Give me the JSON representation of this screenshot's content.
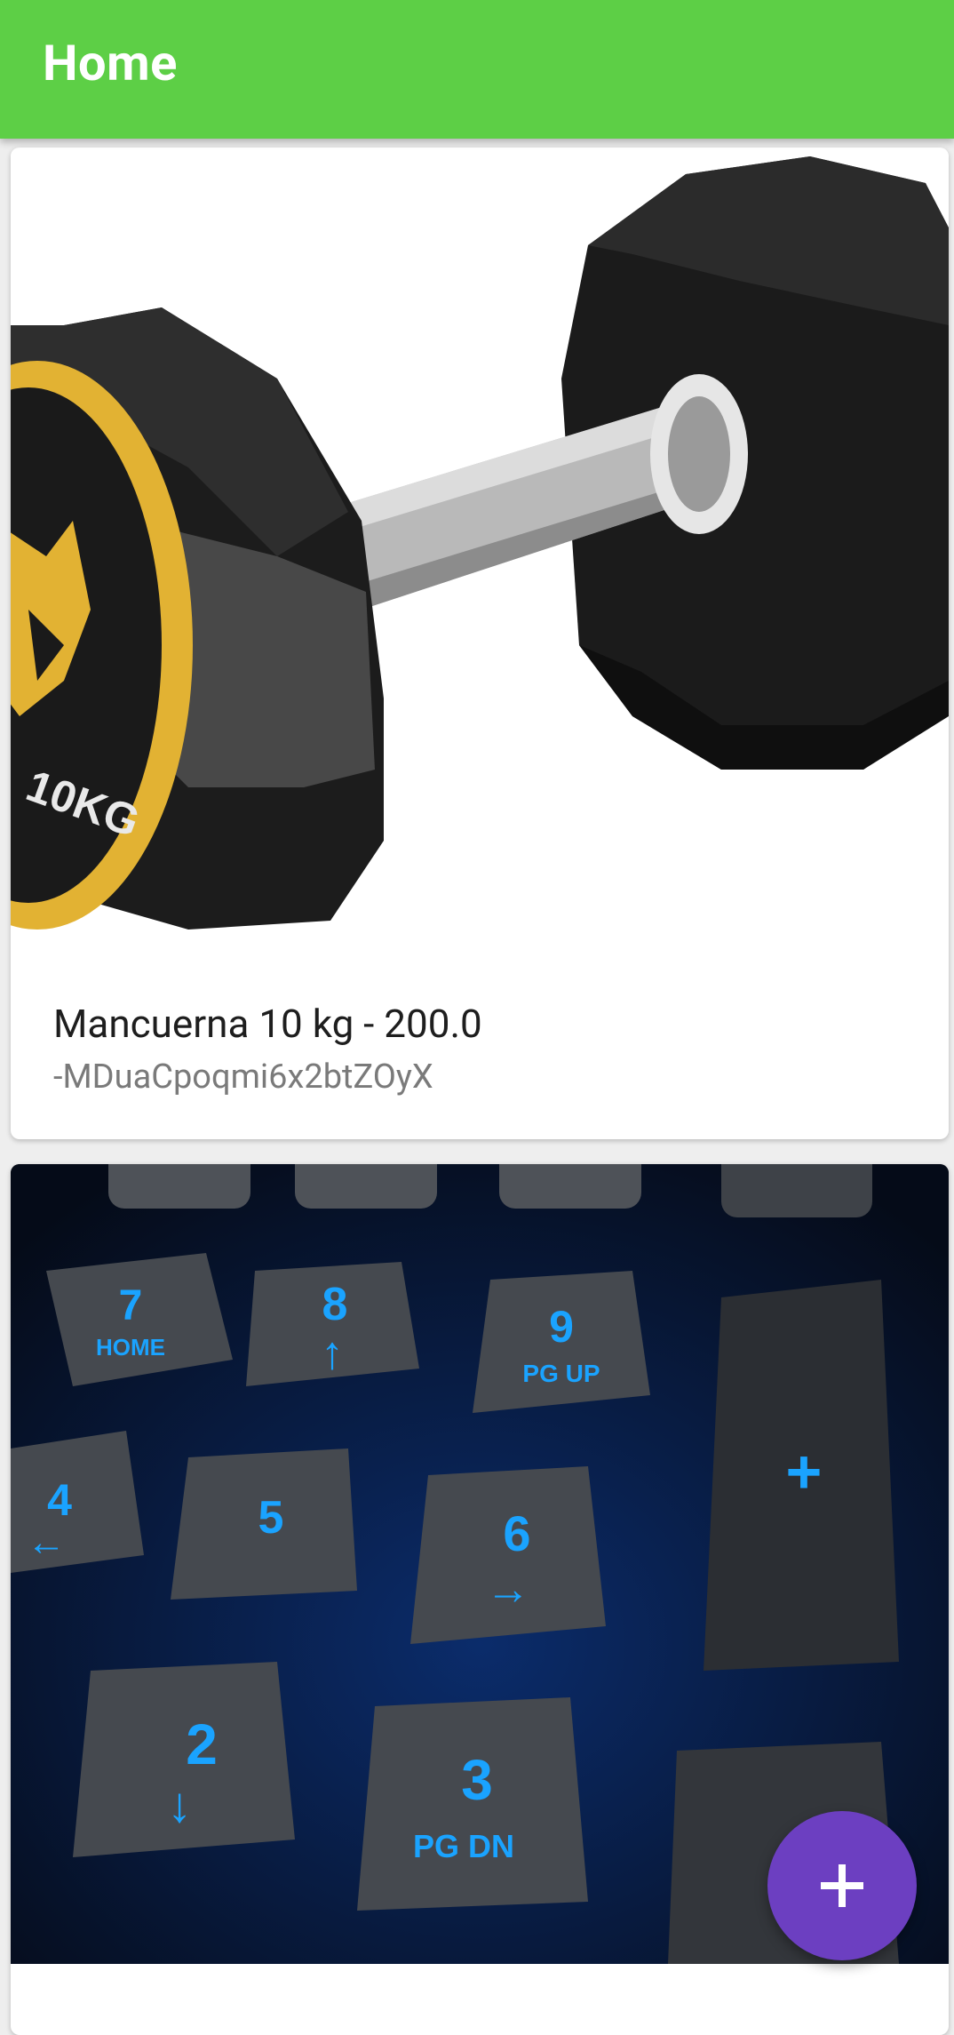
{
  "appbar": {
    "title": "Home"
  },
  "cards": [
    {
      "image_icon": "dumbbell-image",
      "image_text": "10KG",
      "title": "Mancuerna 10 kg - 200.0",
      "subtitle": "-MDuaCpoqmi6x2btZOyX"
    },
    {
      "image_icon": "keyboard-numpad-image",
      "keys": [
        {
          "main": "7",
          "sub": "HOME"
        },
        {
          "main": "8",
          "sub": "↑"
        },
        {
          "main": "9",
          "sub": "PG UP"
        },
        {
          "main": "+",
          "sub": ""
        },
        {
          "main": "4",
          "sub": "←"
        },
        {
          "main": "5",
          "sub": ""
        },
        {
          "main": "6",
          "sub": "→"
        },
        {
          "main": "2",
          "sub": "↓"
        },
        {
          "main": "3",
          "sub": "PG DN"
        }
      ]
    }
  ],
  "fab": {
    "icon": "plus-icon"
  },
  "colors": {
    "appbar": "#5dcf46",
    "fab": "#6c3fc1",
    "key_glow": "#1aa3ff"
  }
}
